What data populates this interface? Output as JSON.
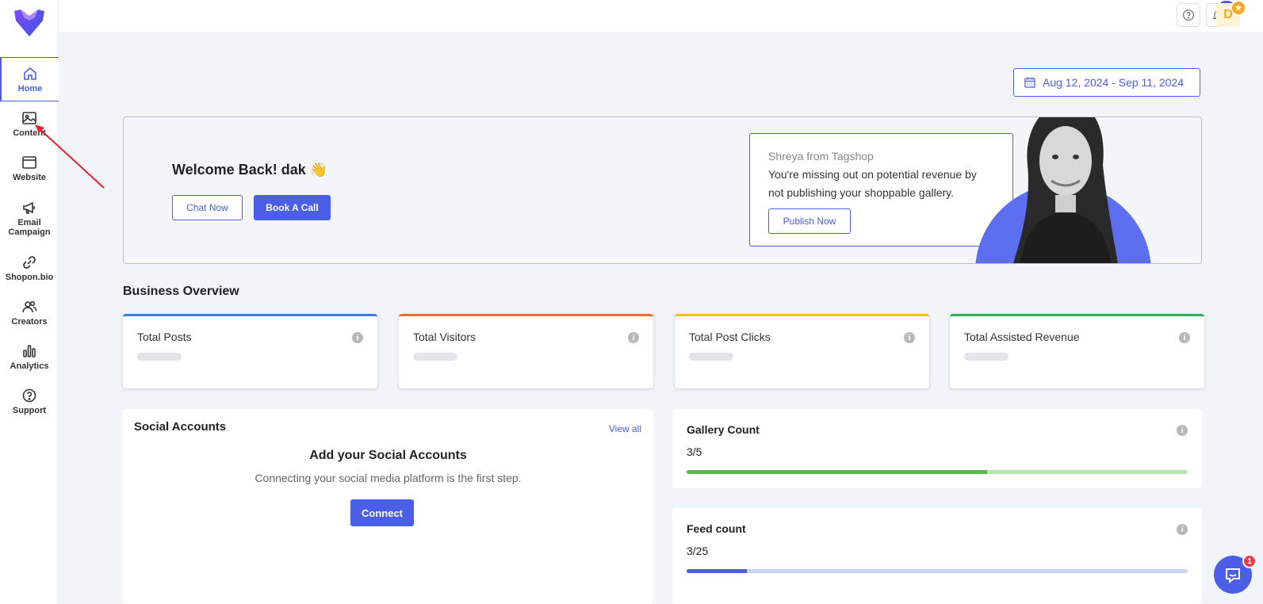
{
  "sidebar": {
    "items": [
      {
        "label": "Home"
      },
      {
        "label": "Content"
      },
      {
        "label": "Website"
      },
      {
        "label": "Email Campaign"
      },
      {
        "label": "Shopon.bio"
      },
      {
        "label": "Creators"
      },
      {
        "label": "Analytics"
      },
      {
        "label": "Support"
      }
    ]
  },
  "topbar": {
    "notification_count": "10",
    "avatar_initial": "D"
  },
  "date_range": "Aug 12, 2024 - Sep 11, 2024",
  "banner": {
    "welcome": "Welcome Back! dak 👋",
    "chat_now": "Chat Now",
    "book_call": "Book A Call",
    "tip_name": "Shreya from Tagshop",
    "tip_text": "You're missing out on potential revenue by not publishing your shoppable gallery.",
    "publish_now": "Publish Now"
  },
  "business_overview": {
    "title": "Business Overview",
    "cards": [
      {
        "label": "Total Posts",
        "color": "#3b7be6"
      },
      {
        "label": "Total Visitors",
        "color": "#ef6c2f"
      },
      {
        "label": "Total Post Clicks",
        "color": "#f5c118"
      },
      {
        "label": "Total Assisted Revenue",
        "color": "#2bb256"
      }
    ]
  },
  "social_accounts": {
    "title": "Social Accounts",
    "view_all": "View all",
    "heading": "Add your Social Accounts",
    "subtext": "Connecting your social media platform is the first step.",
    "connect": "Connect"
  },
  "gallery_count": {
    "label": "Gallery Count",
    "value": "3/5",
    "fraction": 0.6,
    "color": "#5ab84d"
  },
  "feed_count": {
    "label": "Feed count",
    "value": "3/25",
    "fraction": 0.12,
    "color": "#4a5ee8"
  },
  "chat_badge": "1"
}
